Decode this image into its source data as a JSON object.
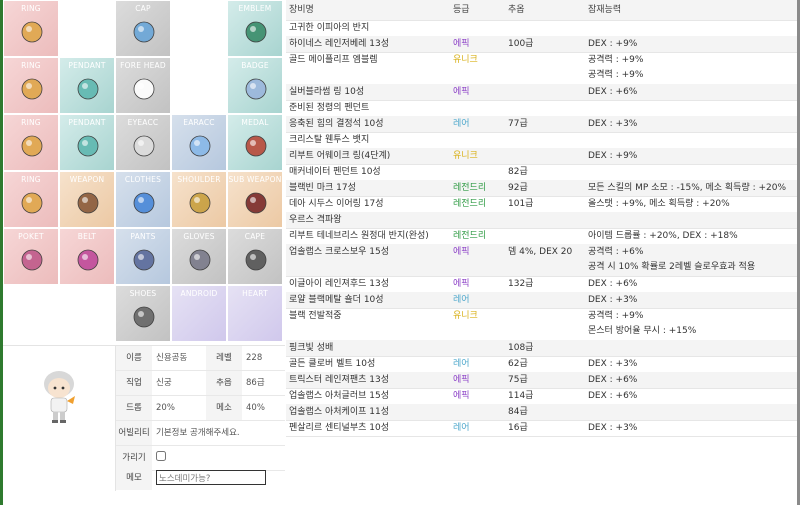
{
  "colors": {
    "epic": "#8e44c8",
    "unique": "#d9b21c",
    "rare": "#4fa8cc",
    "legendary": "#2e9a43"
  },
  "slots": [
    {
      "label": "RING",
      "icon": "ring-icon"
    },
    {
      "label": "",
      "icon": ""
    },
    {
      "label": "CAP",
      "icon": "cap-icon"
    },
    {
      "label": "",
      "icon": ""
    },
    {
      "label": "EMBLEM",
      "icon": "emblem-icon"
    },
    {
      "label": "RING",
      "icon": "ring-icon"
    },
    {
      "label": "PENDANT",
      "icon": "pendant-icon"
    },
    {
      "label": "FORE HEAD",
      "icon": "forehead-icon"
    },
    {
      "label": "",
      "icon": ""
    },
    {
      "label": "BADGE",
      "icon": "badge-icon"
    },
    {
      "label": "RING",
      "icon": "ring-icon"
    },
    {
      "label": "PENDANT",
      "icon": "pendant-icon"
    },
    {
      "label": "EYEACC",
      "icon": "eyeacc-icon"
    },
    {
      "label": "EARACC",
      "icon": "earacc-icon"
    },
    {
      "label": "MEDAL",
      "icon": "medal-icon"
    },
    {
      "label": "RING",
      "icon": "ring-icon"
    },
    {
      "label": "WEAPON",
      "icon": "weapon-icon"
    },
    {
      "label": "CLOTHES",
      "icon": "clothes-icon"
    },
    {
      "label": "SHOULDER",
      "icon": "shoulder-icon"
    },
    {
      "label": "SUB WEAPON",
      "icon": "sub-weapon-icon"
    },
    {
      "label": "POKET",
      "icon": "pocket-icon"
    },
    {
      "label": "BELT",
      "icon": "belt-icon"
    },
    {
      "label": "PANTS",
      "icon": "pants-icon"
    },
    {
      "label": "GLOVES",
      "icon": "gloves-icon"
    },
    {
      "label": "CAPE",
      "icon": "cape-icon"
    },
    {
      "label": "",
      "icon": ""
    },
    {
      "label": "",
      "icon": ""
    },
    {
      "label": "SHOES",
      "icon": "shoes-icon"
    },
    {
      "label": "ANDROID",
      "icon": ""
    },
    {
      "label": "HEART",
      "icon": ""
    }
  ],
  "character": {
    "name_label": "이름",
    "name": "신용공동",
    "level_label": "레벨",
    "level": "228",
    "job_label": "직업",
    "job": "신궁",
    "pop_label": "추옵",
    "pop": "86급",
    "drop_label": "드롭",
    "drop": "20%",
    "meso_label": "메소",
    "meso": "40%",
    "ability_label": "어빌리티",
    "ability": "기본정보 공개해주세요.",
    "hide_label": "가리기",
    "memo_label": "메모",
    "memo_value": "노스데미가능?"
  },
  "table": {
    "headers": {
      "name": "장비명",
      "grade": "등급",
      "stars": "추옵",
      "potential": "잠재능력"
    },
    "rows": [
      {
        "name": "고귀한 이피아의 반지",
        "grade": "",
        "grade_class": "",
        "stars": "",
        "pot": [
          "",
          ""
        ]
      },
      {
        "name": "하이네스 레인저베레 13성",
        "grade": "에픽",
        "grade_class": "epic",
        "stars": "100급",
        "pot": [
          "DEX : +9%",
          ""
        ]
      },
      {
        "name": "골드 메이플리프 엠블렘",
        "grade": "유니크",
        "grade_class": "unique",
        "stars": "",
        "pot": [
          "공격력 : +9%",
          "공격력 : +9%"
        ]
      },
      {
        "name": "실버블라썸 링 10성",
        "grade": "에픽",
        "grade_class": "epic",
        "stars": "",
        "pot": [
          "DEX : +6%",
          ""
        ]
      },
      {
        "name": "준비된 정령의 펜던트",
        "grade": "",
        "grade_class": "",
        "stars": "",
        "pot": [
          "",
          ""
        ]
      },
      {
        "name": "응축된 힘의 결정석 10성",
        "grade": "레어",
        "grade_class": "rare",
        "stars": "77급",
        "pot": [
          "DEX : +3%",
          ""
        ]
      },
      {
        "name": "크리스탈 웬투스 뱃지",
        "grade": "",
        "grade_class": "",
        "stars": "",
        "pot": [
          "",
          ""
        ]
      },
      {
        "name": "리부트 어웨이크 링(4단계)",
        "grade": "유니크",
        "grade_class": "unique",
        "stars": "",
        "pot": [
          "DEX : +9%",
          ""
        ]
      },
      {
        "name": "매커네이터 펜던트 10성",
        "grade": "",
        "grade_class": "",
        "stars": "82급",
        "pot": [
          "",
          ""
        ]
      },
      {
        "name": "블랙빈 마크 17성",
        "grade": "레전드리",
        "grade_class": "legendary",
        "stars": "92급",
        "pot": [
          "모든 스킬의 MP 소모 : -15%, 메소 획득량 : +20%",
          ""
        ]
      },
      {
        "name": "데아 시두스 이어링 17성",
        "grade": "레전드리",
        "grade_class": "legendary",
        "stars": "101급",
        "pot": [
          "올스탯 : +9%, 메소 획득량 : +20%",
          ""
        ]
      },
      {
        "name": "우르스 격파왕",
        "grade": "",
        "grade_class": "",
        "stars": "",
        "pot": [
          "",
          ""
        ]
      },
      {
        "name": "리부트 테네브리스 원정대 반지(완성)",
        "grade": "레전드리",
        "grade_class": "legendary",
        "stars": "",
        "pot": [
          "아이템 드롭률 : +20%, DEX : +18%",
          ""
        ]
      },
      {
        "name": "업솔랩스 크로스보우 15성",
        "grade": "에픽",
        "grade_class": "epic",
        "stars": "뎀 4%, DEX 20",
        "pot": [
          "공격력 : +6%",
          "공격 시 10% 확률로 2레벨 슬로우효과 적용"
        ]
      },
      {
        "name": "이글아이 레인져후드 13성",
        "grade": "에픽",
        "grade_class": "epic",
        "stars": "132급",
        "pot": [
          "DEX : +6%",
          ""
        ]
      },
      {
        "name": "로얄 블랙메탈 숄더 10성",
        "grade": "레어",
        "grade_class": "rare",
        "stars": "",
        "pot": [
          "DEX : +3%",
          ""
        ]
      },
      {
        "name": "블랙 전발적중",
        "grade": "유니크",
        "grade_class": "unique",
        "stars": "",
        "pot": [
          "공격력 : +9%",
          "몬스터 방어율 무시 : +15%"
        ]
      },
      {
        "name": "핑크빛 성배",
        "grade": "",
        "grade_class": "",
        "stars": "108급",
        "pot": [
          "",
          ""
        ]
      },
      {
        "name": "골든 클로버 벨트 10성",
        "grade": "레어",
        "grade_class": "rare",
        "stars": "62급",
        "pot": [
          "DEX : +3%",
          ""
        ]
      },
      {
        "name": "트릭스터 레인져팬츠 13성",
        "grade": "에픽",
        "grade_class": "epic",
        "stars": "75급",
        "pot": [
          "DEX : +6%",
          ""
        ]
      },
      {
        "name": "업솔랩스 아처글러브 15성",
        "grade": "에픽",
        "grade_class": "epic",
        "stars": "114급",
        "pot": [
          "DEX : +6%",
          ""
        ]
      },
      {
        "name": "업솔랩스 아처케이프 11성",
        "grade": "",
        "grade_class": "",
        "stars": "84급",
        "pot": [
          "",
          ""
        ]
      },
      {
        "name": "펜살리르 센티널부츠 10성",
        "grade": "레어",
        "grade_class": "rare",
        "stars": "16급",
        "pot": [
          "DEX : +3%",
          ""
        ]
      }
    ]
  }
}
